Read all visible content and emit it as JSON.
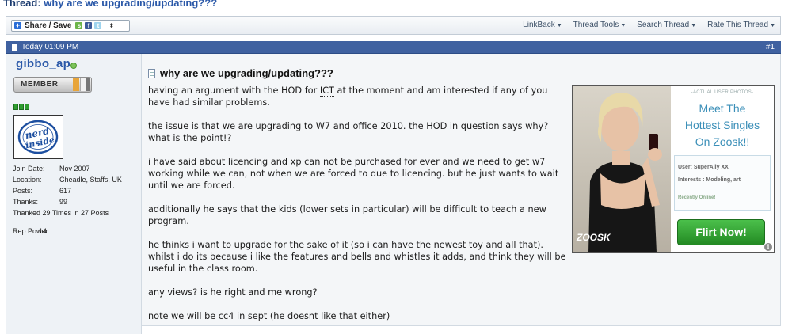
{
  "thread": {
    "prefix": "Thread:",
    "title": "why are we upgrading/updating???"
  },
  "toolbar": {
    "share_label": "Share / Save",
    "tools": [
      "LinkBack",
      "Thread Tools",
      "Search Thread",
      "Rate This Thread"
    ]
  },
  "post": {
    "date": "Today 01:09 PM",
    "number": "#1",
    "title": "why are we upgrading/updating???",
    "paragraphs": [
      "having an argument with the HOD for ICT at the moment and am interested if any of you\nhave had similar problems.",
      "the issue is that we are upgrading to W7 and office 2010. the HOD in question says why?\nwhat is the point!?",
      "i have said about licencing and xp can not be purchased for ever and we need to get w7\nworking while we can, not when we are forced to due to licencing. but he just wants to wait\nuntil we are forced.",
      "additionally he says that the kids (lower sets in particular) will be difficult to teach a new\nprogram.",
      "he thinks i want to upgrade for the sake of it (so i can have the newest toy and all that).\nwhilst i do its because i like the features and bells and whistles it adds, and think they will be\nuseful in the class room.",
      "any views? is he right and me wrong?",
      "note we will be cc4 in sept (he doesnt like that either)"
    ]
  },
  "user": {
    "name": "gibbo_ap",
    "rank": "MEMBER",
    "avatar_text": "nerd inside",
    "stats": [
      {
        "k": "Join Date:",
        "v": "Nov 2007"
      },
      {
        "k": "Location:",
        "v": "Cheadle, Staffs, UK"
      },
      {
        "k": "Posts:",
        "v": "617"
      },
      {
        "k": "Thanks:",
        "v": "99"
      }
    ],
    "thanked": "Thanked 29 Times in 27 Posts",
    "rep_power_label": "Rep Power:",
    "rep_power": "14"
  },
  "ad": {
    "small": "-ACTUAL USER PHOTOS-",
    "headline_lines": [
      "Meet The",
      "Hottest Singles",
      "On Zoosk!!"
    ],
    "user": "User: SuperAlly XX",
    "interests": "Interests : Modeling, art",
    "recent": "Recently Online!",
    "cta": "Flirt Now!",
    "logo": "ZOOSK",
    "info": "i"
  },
  "colors": {
    "header_bar": "#3f61a0",
    "link_blue": "#2a58a8",
    "cta_green": "#3aa83a"
  }
}
